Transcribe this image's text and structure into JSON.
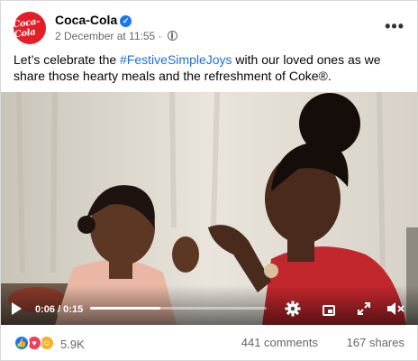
{
  "post": {
    "page_name": "Coca-Cola",
    "avatar_text": "Coca-Cola",
    "timestamp": "2 December at 11:55 ·",
    "caption_before": "Let’s celebrate the ",
    "caption_hashtag": "#FestiveSimpleJoys",
    "caption_after": " with our loved ones as we share those hearty meals and the refreshment of Coke®.",
    "more_label": "•••"
  },
  "video": {
    "time": "0:06 / 0:15",
    "progress": 0.4
  },
  "engagement": {
    "reaction_count": "5.9K",
    "comments": "441 comments",
    "shares": "167 shares"
  },
  "colors": {
    "brand_red": "#e41e26",
    "hashtag": "#216fdb",
    "verified": "#1877f2"
  },
  "icons": [
    "verified-icon",
    "globe-icon",
    "more-icon",
    "play-icon",
    "gear-icon",
    "pip-icon",
    "expand-icon",
    "volume-icon",
    "like-icon",
    "love-icon",
    "care-icon"
  ]
}
